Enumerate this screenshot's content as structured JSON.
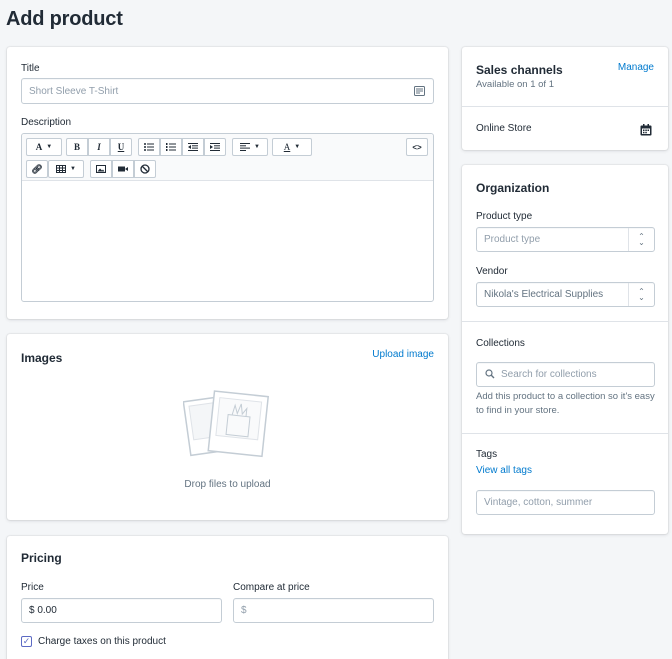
{
  "page": {
    "title": "Add product"
  },
  "product_card": {
    "title_label": "Title",
    "title_placeholder": "Short Sleeve T-Shirt",
    "description_label": "Description",
    "toolbar": {
      "font": "A",
      "bold": "B",
      "italic": "I",
      "underline": "U",
      "font_color": "A",
      "code": "<>"
    }
  },
  "images_card": {
    "heading": "Images",
    "upload_link": "Upload image",
    "drop_text": "Drop files to upload"
  },
  "pricing_card": {
    "heading": "Pricing",
    "price_label": "Price",
    "price_value": "$ 0.00",
    "compare_label": "Compare at price",
    "compare_placeholder": "$",
    "charge_taxes_label": "Charge taxes on this product",
    "charge_taxes_checked": true
  },
  "sales_channels": {
    "heading": "Sales channels",
    "manage_link": "Manage",
    "subtitle": "Available on 1 of 1",
    "online_store": "Online Store"
  },
  "organization": {
    "heading": "Organization",
    "product_type_label": "Product type",
    "product_type_placeholder": "Product type",
    "vendor_label": "Vendor",
    "vendor_value": "Nikola's Electrical Supplies",
    "collections_label": "Collections",
    "collections_placeholder": "Search for collections",
    "collections_help": "Add this product to a collection so it's easy to find in your store.",
    "tags_label": "Tags",
    "view_all_tags": "View all tags",
    "tags_placeholder": "Vintage, cotton, summer"
  },
  "colors": {
    "link": "#007ace",
    "background": "#f4f6f8",
    "text": "#212b36",
    "muted": "#919eab"
  }
}
